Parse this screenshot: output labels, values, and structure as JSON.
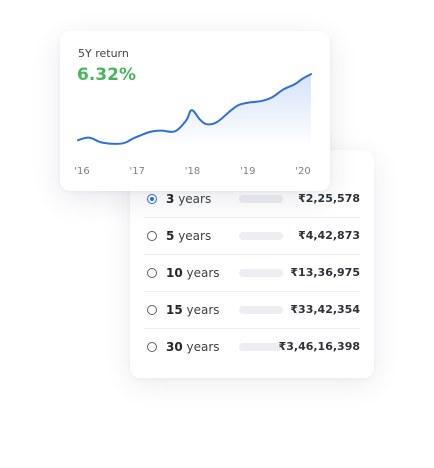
{
  "chart_card": {
    "title": "5Y return",
    "value": "6.32%",
    "value_color": "#47b65a",
    "line_color": "#2f6fd6"
  },
  "chart_data": {
    "type": "area",
    "title": "",
    "x_tick_labels": [
      "'16",
      "'17",
      "'18",
      "'19",
      "'20"
    ],
    "x": [
      2016.0,
      2016.2,
      2016.45,
      2016.8,
      2017.0,
      2017.3,
      2017.5,
      2017.75,
      2017.95,
      2018.05,
      2018.2,
      2018.32,
      2018.5,
      2018.75,
      2018.9,
      2019.1,
      2019.3,
      2019.5,
      2019.7,
      2019.9,
      2020.05,
      2020.2
    ],
    "y": [
      0.9,
      1.3,
      0.5,
      0.4,
      1.2,
      2.2,
      2.4,
      2.3,
      4.0,
      5.6,
      4.1,
      3.4,
      3.7,
      5.5,
      6.4,
      6.8,
      7.0,
      7.6,
      8.8,
      9.6,
      10.5,
      11.2
    ],
    "xlim": [
      2016.0,
      2020.2
    ],
    "ylim": [
      0,
      12
    ],
    "grid": false,
    "legend": "none"
  },
  "returns": {
    "selected_index": 0,
    "rows": [
      {
        "years": "3",
        "unit": "years",
        "amount": "₹2,25,578"
      },
      {
        "years": "5",
        "unit": "years",
        "amount": "₹4,42,873"
      },
      {
        "years": "10",
        "unit": "years",
        "amount": "₹13,36,975"
      },
      {
        "years": "15",
        "unit": "years",
        "amount": "₹33,42,354"
      },
      {
        "years": "30",
        "unit": "years",
        "amount": "₹3,46,16,398"
      }
    ],
    "accent_color": "#2f6fd6"
  }
}
